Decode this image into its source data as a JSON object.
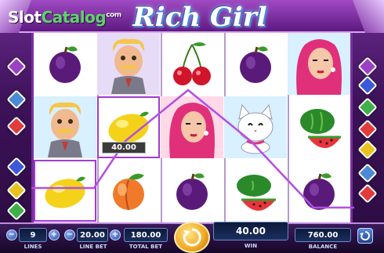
{
  "branding": {
    "logo_slot": "Slot",
    "logo_catalog": "Catalog",
    "logo_suffix": "com",
    "game_title": "Rich Girl"
  },
  "reels": [
    [
      "plum-icon",
      "old-man-icon",
      "lemon-icon"
    ],
    [
      "old-man-icon",
      "lemon-icon",
      "peach-icon"
    ],
    [
      "cherries-icon",
      "rich-girl-icon",
      "plum-icon"
    ],
    [
      "plum-icon",
      "white-cat-icon",
      "watermelon-icon"
    ],
    [
      "rich-girl-icon",
      "watermelon-icon",
      "plum-icon"
    ]
  ],
  "win_overlay": {
    "amount": "40.00"
  },
  "controls": {
    "lines": {
      "label": "LINES",
      "value": "9"
    },
    "line_bet": {
      "label": "LINE BET",
      "value": "20.00"
    },
    "total_bet": {
      "label": "TOTAL BET",
      "value": "180.00"
    },
    "win": {
      "label": "WIN",
      "value": "40.00"
    },
    "balance": {
      "label": "BALANCE",
      "value": "760.00"
    },
    "minus": "−",
    "plus": "+"
  },
  "colors": {
    "frame_purple": "#6b2a8f",
    "panel_blue": "#1b2f5e",
    "payline": "#b34fe0",
    "spin_gold": "#f0a820"
  }
}
